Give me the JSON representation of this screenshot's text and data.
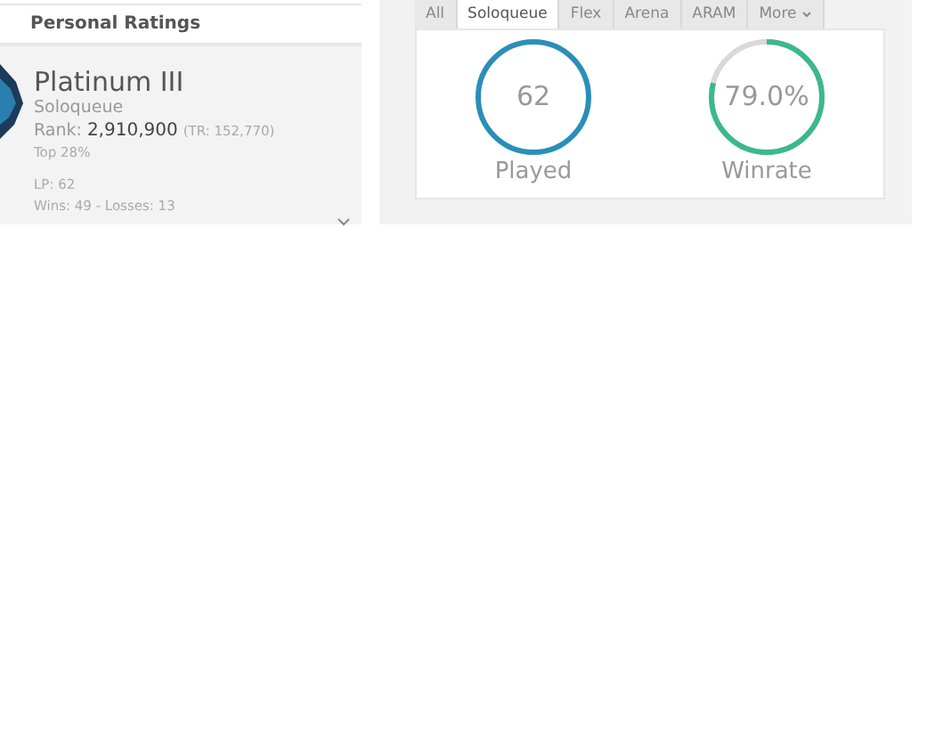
{
  "ratings": {
    "title": "Personal Ratings",
    "tier": "Platinum III",
    "queue": "Soloqueue",
    "rank_label": "Rank:",
    "rank": "2,910,900",
    "tr": "(TR: 152,770)",
    "top": "Top 28%",
    "lp": "LP: 62",
    "record": "Wins: 49 - Losses: 13"
  },
  "tabs": [
    {
      "label": "All",
      "selected": false
    },
    {
      "label": "Soloqueue",
      "selected": true
    },
    {
      "label": "Flex",
      "selected": false
    },
    {
      "label": "Arena",
      "selected": false
    },
    {
      "label": "ARAM",
      "selected": false
    },
    {
      "label": "More",
      "selected": false,
      "kind": "dropdown"
    }
  ],
  "stats": [
    {
      "value": "62",
      "label": "Played",
      "color": "#2a8fb8",
      "kind": "full"
    },
    {
      "value": "79.0%",
      "label": "Winrate",
      "color": "#3bb98a",
      "kind": "ratio",
      "level": 0.79
    }
  ]
}
